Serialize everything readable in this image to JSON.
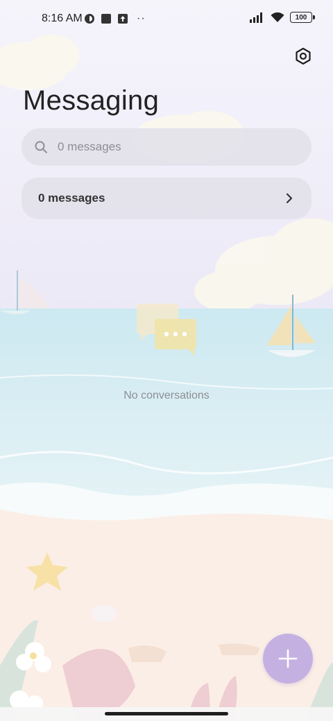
{
  "status_bar": {
    "time": "8:16 AM",
    "battery": "100",
    "left_icons": [
      "hotspot-icon",
      "square-icon",
      "upload-icon"
    ],
    "more": "··"
  },
  "header": {
    "title": "Messaging",
    "settings_icon": "settings-hexagon-icon"
  },
  "search": {
    "placeholder": "0 messages"
  },
  "messages_card": {
    "label": "0 messages"
  },
  "empty_state": {
    "text": "No conversations"
  },
  "fab": {
    "icon": "plus-icon",
    "color": "#c4b1e2"
  },
  "colors": {
    "sky": "#f1eff9",
    "sea": "#cfeaf2",
    "sand": "#fbeee6",
    "accent": "#c4b1e2"
  }
}
